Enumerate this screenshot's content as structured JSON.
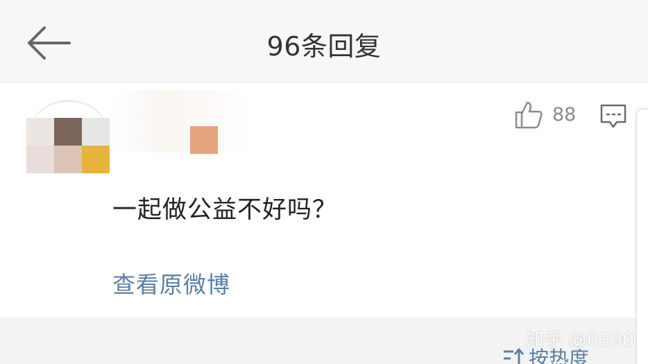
{
  "header": {
    "title": "96条回复",
    "back_icon": "arrow-left-icon"
  },
  "comment": {
    "like_icon": "thumbs-up-icon",
    "like_count": "88",
    "reply_icon": "comment-bubble-icon",
    "text": "一起做公益不好吗？",
    "view_original_label": "查看原微博"
  },
  "sort": {
    "icon": "sort-icon",
    "label": "按热度"
  },
  "watermark": "知乎 @0390",
  "colors": {
    "link": "#5a80a6",
    "header_bg": "#f7f7f7",
    "lower_bg": "#f3f3f3",
    "avatar_pixels": [
      "#ece6e3",
      "#7b655b",
      "#e5e7e4",
      "#e8ddda",
      "#dcc4b6",
      "#e8b33c"
    ],
    "username_pixel": "#e7a57e"
  }
}
